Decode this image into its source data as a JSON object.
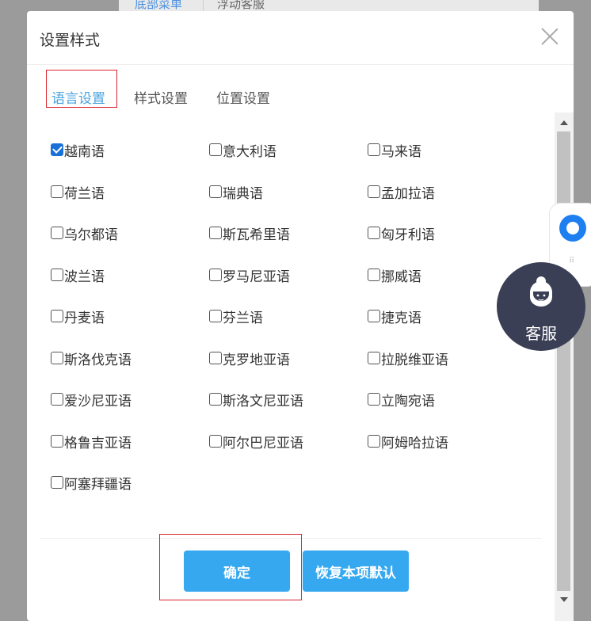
{
  "background": {
    "tabs": [
      "底部菜单",
      "浮动客服"
    ]
  },
  "modal": {
    "title": "设置样式",
    "close_icon": "close-icon",
    "tabs": [
      {
        "label": "语言设置",
        "active": true
      },
      {
        "label": "样式设置",
        "active": false
      },
      {
        "label": "位置设置",
        "active": false
      }
    ],
    "languages": [
      {
        "label": "越南语",
        "checked": true
      },
      {
        "label": "意大利语",
        "checked": false
      },
      {
        "label": "马来语",
        "checked": false
      },
      {
        "label": "荷兰语",
        "checked": false
      },
      {
        "label": "瑞典语",
        "checked": false
      },
      {
        "label": "孟加拉语",
        "checked": false
      },
      {
        "label": "乌尔都语",
        "checked": false
      },
      {
        "label": "斯瓦希里语",
        "checked": false
      },
      {
        "label": "匈牙利语",
        "checked": false
      },
      {
        "label": "波兰语",
        "checked": false
      },
      {
        "label": "罗马尼亚语",
        "checked": false
      },
      {
        "label": "挪威语",
        "checked": false
      },
      {
        "label": "丹麦语",
        "checked": false
      },
      {
        "label": "芬兰语",
        "checked": false
      },
      {
        "label": "捷克语",
        "checked": false
      },
      {
        "label": "斯洛伐克语",
        "checked": false
      },
      {
        "label": "克罗地亚语",
        "checked": false
      },
      {
        "label": "拉脱维亚语",
        "checked": false
      },
      {
        "label": "爱沙尼亚语",
        "checked": false
      },
      {
        "label": "斯洛文尼亚语",
        "checked": false
      },
      {
        "label": "立陶宛语",
        "checked": false
      },
      {
        "label": "格鲁吉亚语",
        "checked": false
      },
      {
        "label": "阿尔巴尼亚语",
        "checked": false
      },
      {
        "label": "阿姆哈拉语",
        "checked": false
      },
      {
        "label": "阿塞拜疆语",
        "checked": false
      }
    ],
    "buttons": {
      "ok": "确定",
      "reset": "恢复本项默认"
    }
  },
  "widget": {
    "service_label": "客服"
  },
  "colors": {
    "accent": "#35a8ef",
    "tab_active": "#4aa3df",
    "highlight": "#d9232d",
    "checkbox_checked": "#1a6fd8",
    "service_bg": "#3a3f55"
  }
}
